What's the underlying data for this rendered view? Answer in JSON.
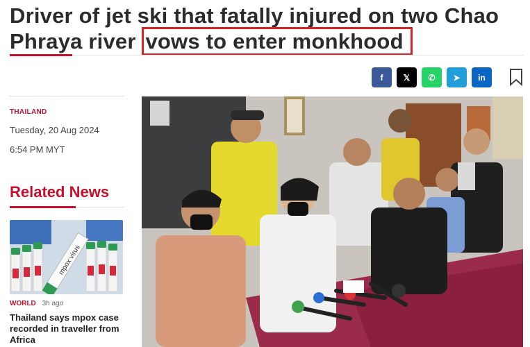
{
  "article": {
    "headline_part1": "Driver of jet ski that fatally injured on two Chao Phraya river ",
    "headline_highlight": "vows to enter monkhood",
    "section": "THAILAND",
    "date": "Tuesday, 20 Aug 2024",
    "time": "6:54 PM MYT"
  },
  "share": {
    "buttons": [
      {
        "name": "facebook",
        "glyph": "f"
      },
      {
        "name": "x",
        "glyph": "𝕏"
      },
      {
        "name": "whatsapp",
        "glyph": "✆"
      },
      {
        "name": "telegram",
        "glyph": "➤"
      },
      {
        "name": "linkedin",
        "glyph": "in"
      }
    ]
  },
  "related": {
    "title": "Related News",
    "items": [
      {
        "category": "WORLD",
        "ago": "3h ago",
        "title": "Thailand says mpox case recorded in traveller from Africa",
        "thumb_label": "mpox virus"
      }
    ]
  },
  "colors": {
    "brand_red": "#c8102e",
    "highlight_box": "#d8232a"
  }
}
